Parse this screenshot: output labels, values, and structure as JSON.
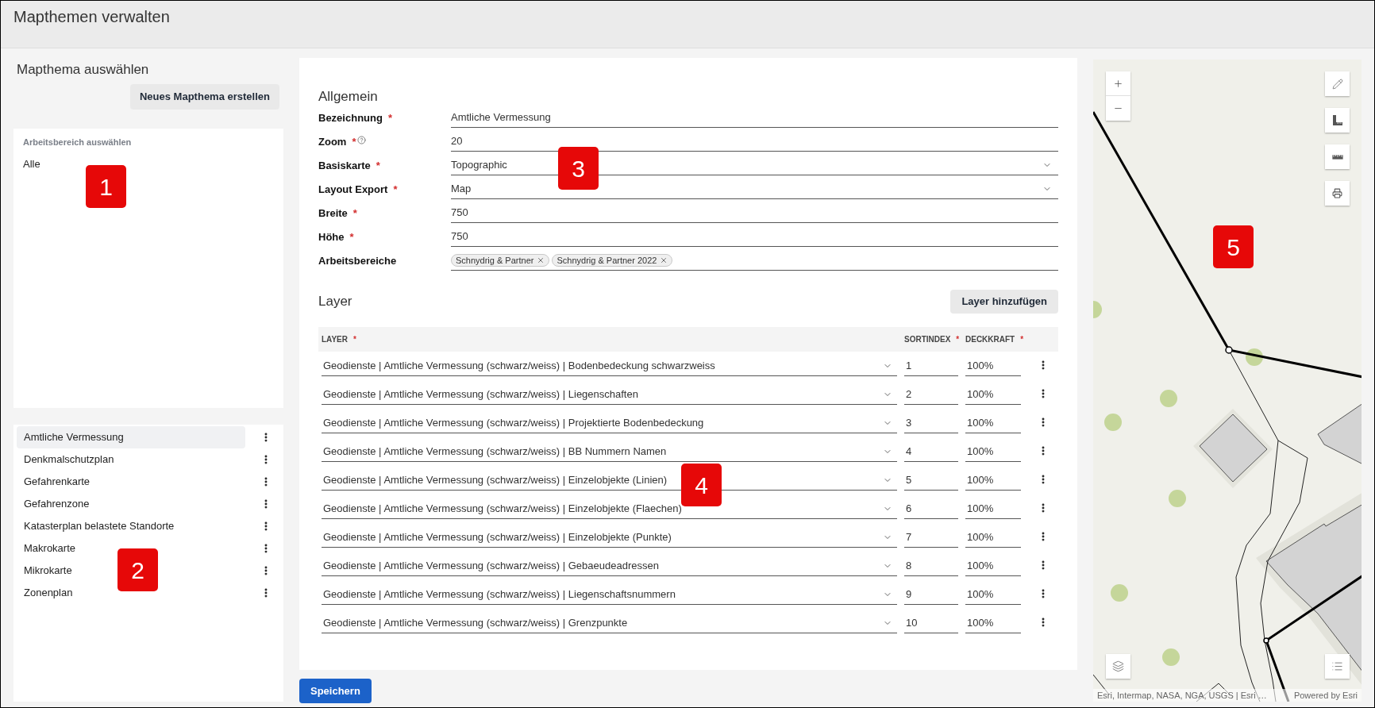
{
  "header": {
    "title": "Mapthemen verwalten"
  },
  "sidebar": {
    "title": "Mapthema auswählen",
    "new_button": "Neues Mapthema erstellen",
    "workspace_filter": {
      "label": "Arbeitsbereich auswählen",
      "value": "Alle"
    },
    "themes": [
      {
        "label": "Amtliche Vermessung",
        "selected": true
      },
      {
        "label": "Denkmalschutzplan",
        "selected": false
      },
      {
        "label": "Gefahrenkarte",
        "selected": false
      },
      {
        "label": "Gefahrenzone",
        "selected": false
      },
      {
        "label": "Katasterplan belastete Standorte",
        "selected": false
      },
      {
        "label": "Makrokarte",
        "selected": false
      },
      {
        "label": "Mikrokarte",
        "selected": false
      },
      {
        "label": "Zonenplan",
        "selected": false
      }
    ]
  },
  "form": {
    "title": "Allgemein",
    "fields": [
      {
        "label": "Bezeichnung",
        "required_mark": "*",
        "kind": "text",
        "value": "Amtliche Vermessung"
      },
      {
        "label": "Zoom",
        "required_mark": "*",
        "help": true,
        "kind": "text",
        "value": "20"
      },
      {
        "label": "Basiskarte",
        "required_mark": "*",
        "kind": "select",
        "value": "Topographic"
      },
      {
        "label": "Layout Export",
        "required_mark": "*",
        "kind": "select",
        "value": "Map"
      },
      {
        "label": "Breite",
        "required_mark": "*",
        "kind": "text",
        "value": "750"
      },
      {
        "label": "Höhe",
        "required_mark": "*",
        "kind": "text",
        "value": "750"
      },
      {
        "label": "Arbeitsbereiche",
        "kind": "tags",
        "tags": [
          "Schnydrig & Partner",
          "Schnydrig & Partner 2022"
        ]
      }
    ]
  },
  "layers": {
    "title": "Layer",
    "add_button": "Layer hinzufügen",
    "columns": [
      {
        "label": "LAYER",
        "required_mark": "*"
      },
      {
        "label": "SORTINDEX",
        "required_mark": "*"
      },
      {
        "label": "DECKKRAFT",
        "required_mark": "*"
      }
    ],
    "rows": [
      {
        "layer": "Geodienste | Amtliche Vermessung (schwarz/weiss) | Bodenbedeckung schwarzweiss",
        "sortindex": "1",
        "opacity": "100%"
      },
      {
        "layer": "Geodienste | Amtliche Vermessung (schwarz/weiss) | Liegenschaften",
        "sortindex": "2",
        "opacity": "100%"
      },
      {
        "layer": "Geodienste | Amtliche Vermessung (schwarz/weiss) | Projektierte Bodenbedeckung",
        "sortindex": "3",
        "opacity": "100%"
      },
      {
        "layer": "Geodienste | Amtliche Vermessung (schwarz/weiss) | BB Nummern Namen",
        "sortindex": "4",
        "opacity": "100%"
      },
      {
        "layer": "Geodienste | Amtliche Vermessung (schwarz/weiss) | Einzelobjekte (Linien)",
        "sortindex": "5",
        "opacity": "100%"
      },
      {
        "layer": "Geodienste | Amtliche Vermessung (schwarz/weiss) | Einzelobjekte (Flaechen)",
        "sortindex": "6",
        "opacity": "100%"
      },
      {
        "layer": "Geodienste | Amtliche Vermessung (schwarz/weiss) | Einzelobjekte (Punkte)",
        "sortindex": "7",
        "opacity": "100%"
      },
      {
        "layer": "Geodienste | Amtliche Vermessung (schwarz/weiss) | Gebaeudeadressen",
        "sortindex": "8",
        "opacity": "100%"
      },
      {
        "layer": "Geodienste | Amtliche Vermessung (schwarz/weiss) | Liegenschaftsnummern",
        "sortindex": "9",
        "opacity": "100%"
      },
      {
        "layer": "Geodienste | Amtliche Vermessung (schwarz/weiss) | Grenzpunkte",
        "sortindex": "10",
        "opacity": "100%"
      }
    ]
  },
  "save_button": "Speichern",
  "map": {
    "attribution": "Esri, Intermap, NASA, NGA, USGS | Esri …",
    "powered_by": "Powered by Esri"
  },
  "callouts": [
    {
      "label": "1"
    },
    {
      "label": "2"
    },
    {
      "label": "3"
    },
    {
      "label": "4"
    },
    {
      "label": "5"
    }
  ]
}
